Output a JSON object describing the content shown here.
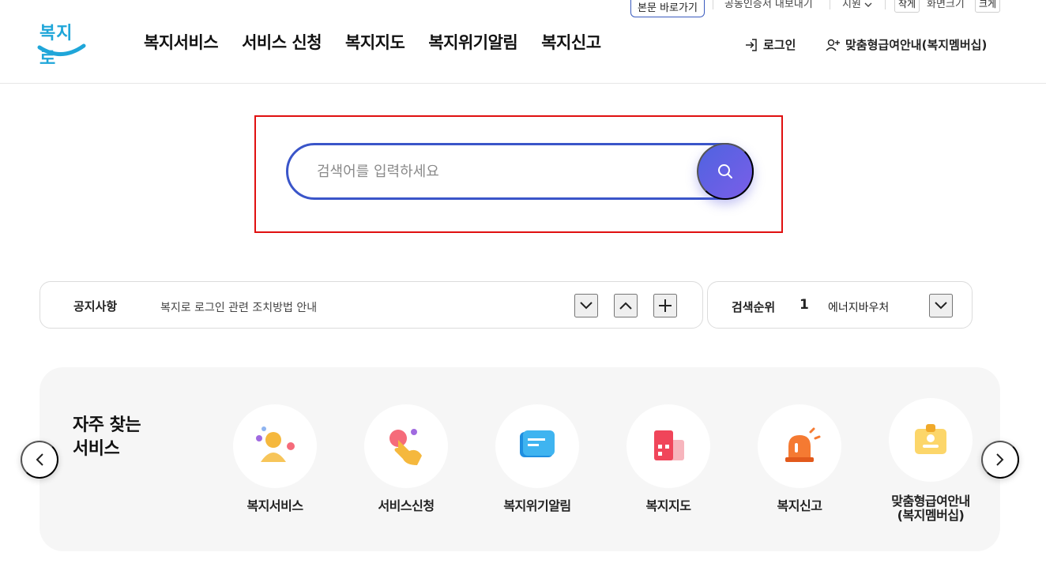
{
  "utility": {
    "skip_link": "본문 바로가기",
    "cert_export": "공동인증서 내보내기",
    "support": "지원",
    "font_small": "작게",
    "font_size_label": "화면크기",
    "font_large": "크게"
  },
  "header": {
    "logo_text": "복지로",
    "nav": [
      "복지서비스",
      "서비스 신청",
      "복지지도",
      "복지위기알림",
      "복지신고"
    ],
    "login": "로그인",
    "membership": "맞춤형급여안내(복지멤버십)"
  },
  "search": {
    "placeholder": "검색어를 입력하세요",
    "value": ""
  },
  "notice": {
    "label": "공지사항",
    "text": "복지로 로그인 관련 조치방법 안내"
  },
  "ranking": {
    "label": "검색순위",
    "number": "1",
    "text": "에너지바우처"
  },
  "frequent": {
    "title_line1": "자주 찾는",
    "title_line2": "서비스",
    "items": [
      {
        "label": "복지서비스",
        "icon": "person-icon"
      },
      {
        "label": "서비스신청",
        "icon": "tap-hand-icon"
      },
      {
        "label": "복지위기알림",
        "icon": "message-icon"
      },
      {
        "label": "복지지도",
        "icon": "building-map-icon"
      },
      {
        "label": "복지신고",
        "icon": "siren-icon"
      },
      {
        "label_line1": "맞춤형급여안내",
        "label_line2": "(복지멤버십)",
        "icon": "id-badge-icon"
      }
    ]
  },
  "colors": {
    "accent_blue": "#3a55c9",
    "logo_blue": "#1fa6d9",
    "highlight_red": "#e01010"
  }
}
